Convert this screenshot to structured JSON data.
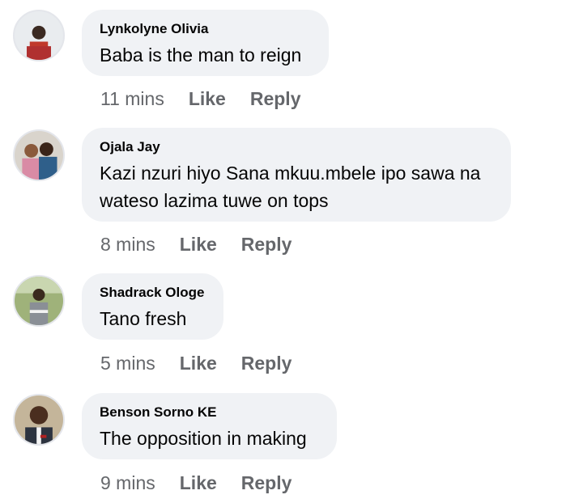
{
  "comments": [
    {
      "author": "Lynkolyne Olivia",
      "text": "Baba is the man to reign",
      "time": "11 mins",
      "like": "Like",
      "reply": "Reply"
    },
    {
      "author": "Ojala Jay",
      "text": "Kazi nzuri hiyo Sana mkuu.mbele ipo sawa na wateso lazima tuwe on tops",
      "time": "8 mins",
      "like": "Like",
      "reply": "Reply"
    },
    {
      "author": "Shadrack Ologe",
      "text": "Tano fresh",
      "time": "5 mins",
      "like": "Like",
      "reply": "Reply"
    },
    {
      "author": "Benson Sorno KE",
      "text": "The opposition in making",
      "time": "9 mins",
      "like": "Like",
      "reply": "Reply"
    }
  ],
  "colors": {
    "bubble": "#f0f2f5",
    "meta_text": "#65676b",
    "author_text": "#050505"
  }
}
